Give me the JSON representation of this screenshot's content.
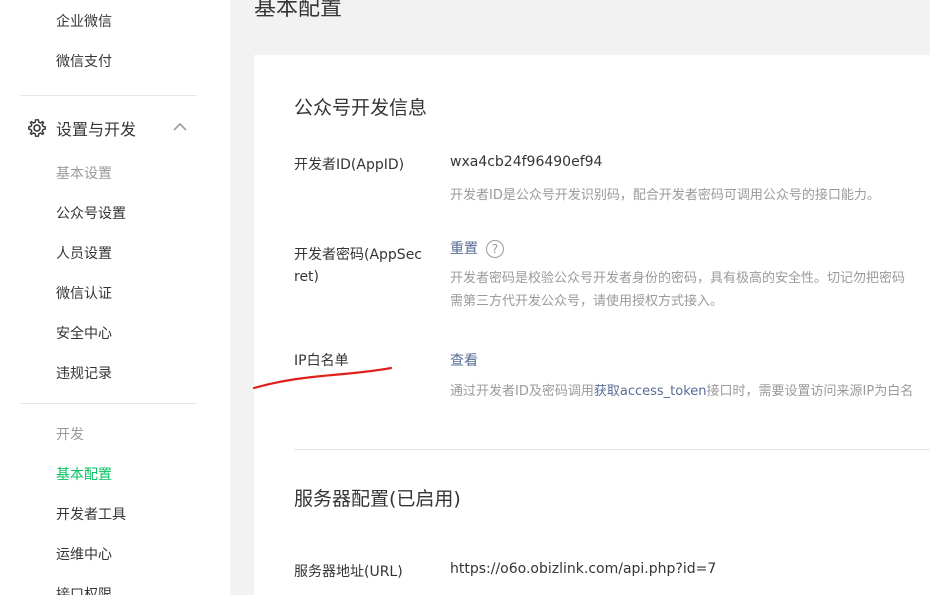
{
  "sidebar": {
    "top_items": [
      "企业微信",
      "微信支付"
    ],
    "section": {
      "icon": "gear-icon",
      "title": "设置与开发",
      "chevron_icon": "chevron-up-icon"
    },
    "group_basic": {
      "title": "基本设置",
      "items": [
        "公众号设置",
        "人员设置",
        "微信认证",
        "安全中心",
        "违规记录"
      ]
    },
    "group_dev": {
      "title": "开发",
      "items": [
        "基本配置",
        "开发者工具",
        "运维中心",
        "接口权限"
      ],
      "active": "基本配置"
    }
  },
  "main": {
    "page_title": "基本配置",
    "dev_info": {
      "title": "公众号开发信息",
      "appid_label": "开发者ID(AppID)",
      "appid_value": "wxa4cb24f96490ef94",
      "appid_desc": "开发者ID是公众号开发识别码，配合开发者密码可调用公众号的接口能力。",
      "secret_label": "开发者密码(AppSecret)",
      "secret_action": "重置",
      "secret_help_icon": "?",
      "secret_desc_1": "开发者密码是校验公众号开发者身份的密码，具有极高的安全性。切记勿把密码",
      "secret_desc_2": "需第三方代开发公众号，请使用授权方式接入。",
      "ip_label": "IP白名单",
      "ip_action": "查看",
      "ip_desc_prefix": "通过开发者ID及密码调用",
      "ip_desc_link": "获取access_token",
      "ip_desc_suffix": "接口时，需要设置访问来源IP为白名"
    },
    "server_config": {
      "title": "服务器配置(已启用)",
      "url_label": "服务器地址(URL)",
      "url_value": "https://o6o.obizlink.com/api.php?id=7"
    }
  },
  "colors": {
    "accent": "#07c160",
    "link": "#576b95",
    "annotation": "#e0201b"
  }
}
